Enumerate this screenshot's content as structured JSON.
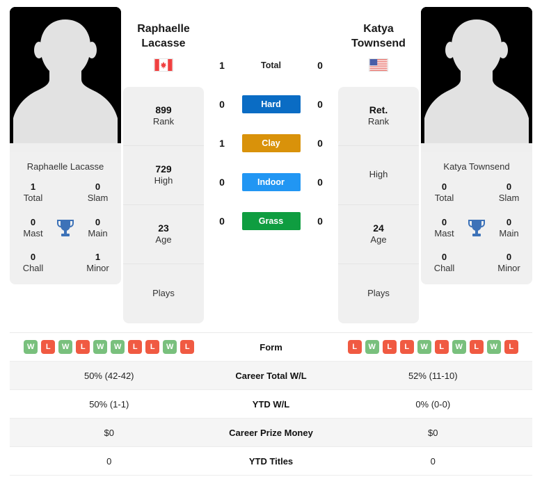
{
  "left_player": {
    "header_name_line1": "Raphaelle",
    "header_name_line2": "Lacasse",
    "card_name": "Raphaelle Lacasse",
    "flag": "canada-flag",
    "rank_value": "899",
    "rank_label": "Rank",
    "high_value": "729",
    "high_label": "High",
    "age_value": "23",
    "age_label": "Age",
    "plays_value": "",
    "plays_label": "Plays",
    "titles": {
      "total_value": "1",
      "total_label": "Total",
      "slam_value": "0",
      "slam_label": "Slam",
      "mast_value": "0",
      "mast_label": "Mast",
      "main_value": "0",
      "main_label": "Main",
      "chall_value": "0",
      "chall_label": "Chall",
      "minor_value": "1",
      "minor_label": "Minor"
    },
    "form": [
      "W",
      "L",
      "W",
      "L",
      "W",
      "W",
      "L",
      "L",
      "W",
      "L"
    ],
    "career_total_wl": "50% (42-42)",
    "ytd_wl": "50% (1-1)",
    "career_prize_money": "$0",
    "ytd_titles": "0",
    "surface_wins": {
      "total": "1",
      "hard": "0",
      "clay": "1",
      "indoor": "0",
      "grass": "0"
    }
  },
  "right_player": {
    "header_name_line1": "Katya",
    "header_name_line2": "Townsend",
    "card_name": "Katya Townsend",
    "flag": "usa-flag",
    "rank_value": "Ret.",
    "rank_label": "Rank",
    "high_value": "",
    "high_label": "High",
    "age_value": "24",
    "age_label": "Age",
    "plays_value": "",
    "plays_label": "Plays",
    "titles": {
      "total_value": "0",
      "total_label": "Total",
      "slam_value": "0",
      "slam_label": "Slam",
      "mast_value": "0",
      "mast_label": "Mast",
      "main_value": "0",
      "main_label": "Main",
      "chall_value": "0",
      "chall_label": "Chall",
      "minor_value": "0",
      "minor_label": "Minor"
    },
    "form": [
      "L",
      "W",
      "L",
      "L",
      "W",
      "L",
      "W",
      "L",
      "W",
      "L"
    ],
    "career_total_wl": "52% (11-10)",
    "ytd_wl": "0% (0-0)",
    "career_prize_money": "$0",
    "ytd_titles": "0",
    "surface_wins": {
      "total": "0",
      "hard": "0",
      "clay": "0",
      "indoor": "0",
      "grass": "0"
    }
  },
  "surfaces": [
    {
      "key": "total",
      "label": "Total",
      "color": ""
    },
    {
      "key": "hard",
      "label": "Hard",
      "color": "#0a6cc4"
    },
    {
      "key": "clay",
      "label": "Clay",
      "color": "#d9920a"
    },
    {
      "key": "indoor",
      "label": "Indoor",
      "color": "#2196f3"
    },
    {
      "key": "grass",
      "label": "Grass",
      "color": "#0f9d40"
    }
  ],
  "table": {
    "form_label": "Form",
    "career_total_wl_label": "Career Total W/L",
    "ytd_wl_label": "YTD W/L",
    "career_prize_money_label": "Career Prize Money",
    "ytd_titles_label": "YTD Titles"
  },
  "colors": {
    "win_badge": "#79c07d",
    "loss_badge": "#f05a42",
    "card_bg": "#f0f0f0",
    "trophy": "#3d72b8"
  }
}
